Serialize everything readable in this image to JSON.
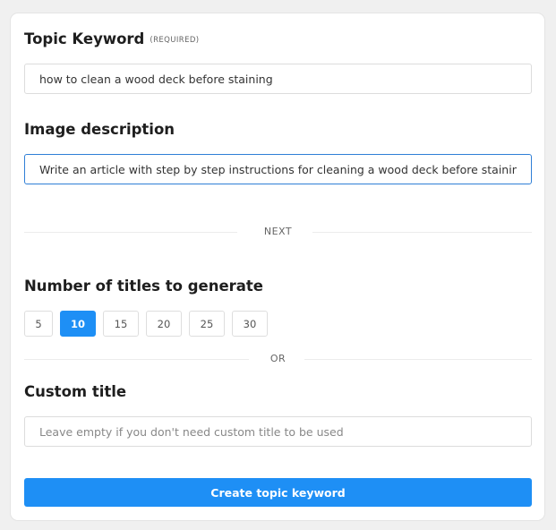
{
  "topic_keyword": {
    "label": "Topic Keyword",
    "required_tag": "(REQUIRED)",
    "value": "how to clean a wood deck before staining"
  },
  "image_description": {
    "label": "Image description",
    "value": "Write an article with step by step instructions for cleaning a wood deck before staining"
  },
  "divider_next": "NEXT",
  "titles_count": {
    "label": "Number of titles to generate",
    "options": [
      "5",
      "10",
      "15",
      "20",
      "25",
      "30"
    ],
    "selected": "10"
  },
  "divider_or": "OR",
  "custom_title": {
    "label": "Custom title",
    "placeholder": "Leave empty if you don't need custom title to be used",
    "value": ""
  },
  "submit_label": "Create topic keyword",
  "colors": {
    "accent": "#1e8ff5",
    "focus_border": "#2f7fd6"
  }
}
